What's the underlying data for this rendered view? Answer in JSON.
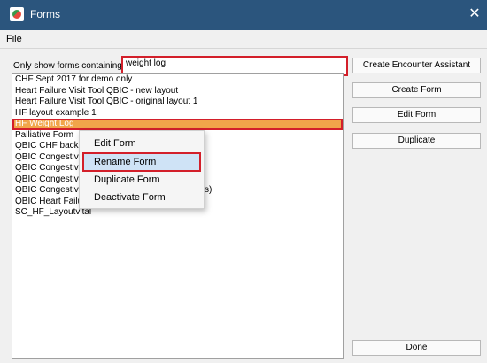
{
  "window": {
    "title": "Forms",
    "icon": "app-form-icon",
    "close_icon": "close-icon"
  },
  "menu": {
    "file": "File"
  },
  "filter": {
    "label": "Only show forms containing:",
    "value": "weight log"
  },
  "forms_list": [
    "CHF Sept 2017 for demo only",
    "Heart Failure Visit Tool QBIC - new layout",
    "Heart Failure Visit Tool QBIC - original layout 1",
    "HF layout example 1",
    "HF Weight Log",
    "Palliative Form",
    "QBIC CHF backup",
    "QBIC Congestive H",
    "QBIC Congestive H",
    "QBIC Congestive H",
    "QBIC Congestive Heart Failure CHF (N_Hastings)",
    "QBIC Heart Failure HF - Dr Spanglet",
    "SC_HF_Layoutvital"
  ],
  "selected_index": 4,
  "context_menu": {
    "items": [
      "Edit Form",
      "Rename Form",
      "Duplicate Form",
      "Deactivate Form"
    ],
    "highlighted": "Rename Form"
  },
  "buttons": {
    "create_encounter_assistant": "Create Encounter Assistant",
    "create_form": "Create Form",
    "edit_form": "Edit Form",
    "duplicate": "Duplicate",
    "done": "Done"
  },
  "colors": {
    "titlebar": "#2b557d",
    "selection": "#f1a54a",
    "highlight_outline": "#d31f2a",
    "menu_hover": "#cfe3f6"
  }
}
